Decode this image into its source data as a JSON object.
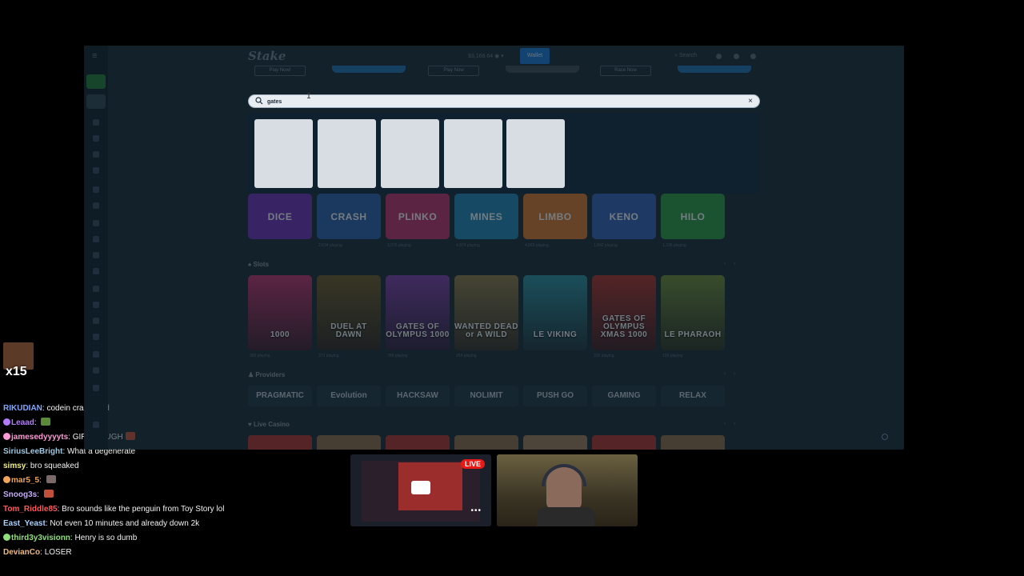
{
  "casino": {
    "logo": "Stake",
    "balance": "$3,168.64",
    "wallet_label": "Wallet",
    "search_label": "Search",
    "promo_buttons": [
      "Play Now!",
      "Play Now",
      "Race Now"
    ],
    "search": {
      "value": "gates",
      "placeholder": ""
    },
    "originals": [
      {
        "name": "DICE",
        "playing": "",
        "color": "#6a2fb5"
      },
      {
        "name": "CRASH",
        "playing": "2,634 playing",
        "color": "#2b5fa8"
      },
      {
        "name": "PLINKO",
        "playing": "3,075 playing",
        "color": "#b8326e"
      },
      {
        "name": "MINES",
        "playing": "4,874 playing",
        "color": "#1f84b5"
      },
      {
        "name": "LIMBO",
        "playing": "4,865 playing",
        "color": "#d0752d"
      },
      {
        "name": "KENO",
        "playing": "1,842 playing",
        "color": "#2f5fb5"
      },
      {
        "name": "HILO",
        "playing": "1,336 playing",
        "color": "#2c9a45"
      }
    ],
    "slots_heading": "Slots",
    "slots": [
      {
        "name": "1000",
        "playing": "386 playing",
        "color": "#b8326e"
      },
      {
        "name": "DUEL AT DAWN",
        "playing": "373 playing",
        "color": "#6b5a2a"
      },
      {
        "name": "GATES OF OLYMPUS 1000",
        "playing": "789 playing",
        "color": "#7a3fa8"
      },
      {
        "name": "WANTED DEAD or A WILD",
        "playing": "264 playing",
        "color": "#8a7a4a"
      },
      {
        "name": "LE VIKING",
        "playing": "",
        "color": "#2a8fa0"
      },
      {
        "name": "GATES OF OLYMPUS XMAS 1000",
        "playing": "336 playing",
        "color": "#a8322e"
      },
      {
        "name": "LE PHARAOH",
        "playing": "199 playing",
        "color": "#6a8a3a"
      }
    ],
    "providers_heading": "Providers",
    "providers": [
      "PRAGMATIC",
      "Evolution",
      "HACKSAW",
      "NOLIMIT",
      "PUSH GO",
      "GAMING",
      "RELAX"
    ],
    "live_heading": "Live Casino"
  },
  "chat": {
    "badge": "x15",
    "messages": [
      {
        "user": "RIKUDIAN",
        "text": "codein crackhead",
        "color": "#7fa7ff",
        "emote": ""
      },
      {
        "user": "Leaad",
        "text": "",
        "color": "#b37bff",
        "emote": "#5a8a3a"
      },
      {
        "user": "jamesedyyyyts",
        "text": "GIRL COUGH",
        "color": "#ff9ad6",
        "emote": "#c0503a"
      },
      {
        "user": "SiriusLeeBright",
        "text": "What a degenerate",
        "color": "#9ec7e0",
        "emote": ""
      },
      {
        "user": "simsy",
        "text": "bro squeaked",
        "color": "#f3f07a",
        "emote": ""
      },
      {
        "user": "mar5_5",
        "text": "",
        "color": "#f2a65a",
        "emote": "#7a6a6a"
      },
      {
        "user": "Snoog3s",
        "text": "",
        "color": "#c7a8ff",
        "emote": "#c0503a"
      },
      {
        "user": "Tom_Riddle85",
        "text": "Bro sounds like the penguin from Toy Story lol",
        "color": "#ff5a5a",
        "emote": ""
      },
      {
        "user": "East_Yeast",
        "text": "Not even 10 minutes and already down 2k",
        "color": "#a9d0ff",
        "emote": ""
      },
      {
        "user": "third3y3visionn",
        "text": "Henry is so dumb",
        "color": "#8fe07a",
        "emote": ""
      },
      {
        "user": "DevianCo",
        "text": "LOSER",
        "color": "#f0b97a",
        "emote": ""
      }
    ]
  },
  "stream": {
    "live_label": "LIVE",
    "more": "•••"
  }
}
